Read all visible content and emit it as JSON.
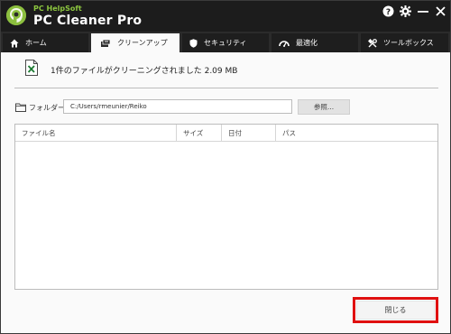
{
  "app": {
    "brand_small": "PC HelpSoft",
    "brand_main": "PC Cleaner Pro"
  },
  "titlebar": {
    "icons": [
      "help-icon",
      "gear-icon",
      "minimize-icon",
      "close-icon"
    ]
  },
  "tabs": [
    {
      "label": "ホーム",
      "icon": "home-icon",
      "active": false
    },
    {
      "label": "クリーンアップ",
      "icon": "cleanup-icon",
      "active": true
    },
    {
      "label": "セキュリティ",
      "icon": "shield-icon",
      "active": false
    },
    {
      "label": "最適化",
      "icon": "speedometer-icon",
      "active": false
    },
    {
      "label": "ツールボックス",
      "icon": "tools-icon",
      "active": false
    }
  ],
  "summary": {
    "text": "1件のファイルがクリーニングされました 2.09 MB",
    "icon": "excel-file-icon"
  },
  "folder": {
    "label": "フォルダー",
    "path": "C:/Users/rmeunier/Reiko",
    "browse_label": "参照..."
  },
  "table": {
    "columns": [
      "ファイル名",
      "サイズ",
      "日付",
      "パス"
    ],
    "rows": []
  },
  "footer": {
    "close_label": "閉じる"
  },
  "colors": {
    "accent_green": "#8cc63f",
    "titlebar_bg": "#1c1c1c",
    "highlight_red": "#e01010"
  }
}
